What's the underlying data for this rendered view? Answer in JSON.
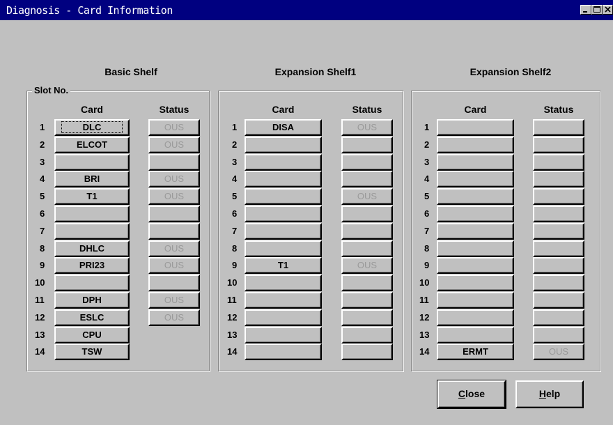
{
  "window": {
    "title": "Diagnosis - Card Information"
  },
  "titlebar_buttons": [
    "minimize-icon",
    "maximize-icon",
    "close-icon"
  ],
  "group_label": "Slot No.",
  "column_headers": {
    "card": "Card",
    "status": "Status"
  },
  "shelves": [
    {
      "title": "Basic Shelf",
      "slots": [
        {
          "num": "1",
          "card": "DLC",
          "status": "OUS",
          "status_visible": true,
          "focused": true
        },
        {
          "num": "2",
          "card": "ELCOT",
          "status": "OUS",
          "status_visible": true
        },
        {
          "num": "3",
          "card": "",
          "status": "",
          "status_visible": true
        },
        {
          "num": "4",
          "card": "BRI",
          "status": "OUS",
          "status_visible": true
        },
        {
          "num": "5",
          "card": "T1",
          "status": "OUS",
          "status_visible": true
        },
        {
          "num": "6",
          "card": "",
          "status": "",
          "status_visible": true
        },
        {
          "num": "7",
          "card": "",
          "status": "",
          "status_visible": true
        },
        {
          "num": "8",
          "card": "DHLC",
          "status": "OUS",
          "status_visible": true
        },
        {
          "num": "9",
          "card": "PRI23",
          "status": "OUS",
          "status_visible": true
        },
        {
          "num": "10",
          "card": "",
          "status": "",
          "status_visible": true
        },
        {
          "num": "11",
          "card": "DPH",
          "status": "OUS",
          "status_visible": true
        },
        {
          "num": "12",
          "card": "ESLC",
          "status": "OUS",
          "status_visible": true
        },
        {
          "num": "13",
          "card": "CPU",
          "status": "",
          "status_visible": false
        },
        {
          "num": "14",
          "card": "TSW",
          "status": "",
          "status_visible": false
        }
      ]
    },
    {
      "title": "Expansion Shelf1",
      "slots": [
        {
          "num": "1",
          "card": "DISA",
          "status": "OUS",
          "status_visible": true
        },
        {
          "num": "2",
          "card": "",
          "status": "",
          "status_visible": true
        },
        {
          "num": "3",
          "card": "",
          "status": "",
          "status_visible": true
        },
        {
          "num": "4",
          "card": "",
          "status": "",
          "status_visible": true
        },
        {
          "num": "5",
          "card": "",
          "status": "OUS",
          "status_visible": true
        },
        {
          "num": "6",
          "card": "",
          "status": "",
          "status_visible": true
        },
        {
          "num": "7",
          "card": "",
          "status": "",
          "status_visible": true
        },
        {
          "num": "8",
          "card": "",
          "status": "",
          "status_visible": true
        },
        {
          "num": "9",
          "card": "T1",
          "status": "OUS",
          "status_visible": true
        },
        {
          "num": "10",
          "card": "",
          "status": "",
          "status_visible": true
        },
        {
          "num": "11",
          "card": "",
          "status": "",
          "status_visible": true
        },
        {
          "num": "12",
          "card": "",
          "status": "",
          "status_visible": true
        },
        {
          "num": "13",
          "card": "",
          "status": "",
          "status_visible": true
        },
        {
          "num": "14",
          "card": "",
          "status": "",
          "status_visible": true
        }
      ]
    },
    {
      "title": "Expansion Shelf2",
      "slots": [
        {
          "num": "1",
          "card": "",
          "status": "",
          "status_visible": true
        },
        {
          "num": "2",
          "card": "",
          "status": "",
          "status_visible": true
        },
        {
          "num": "3",
          "card": "",
          "status": "",
          "status_visible": true
        },
        {
          "num": "4",
          "card": "",
          "status": "",
          "status_visible": true
        },
        {
          "num": "5",
          "card": "",
          "status": "",
          "status_visible": true
        },
        {
          "num": "6",
          "card": "",
          "status": "",
          "status_visible": true
        },
        {
          "num": "7",
          "card": "",
          "status": "",
          "status_visible": true
        },
        {
          "num": "8",
          "card": "",
          "status": "",
          "status_visible": true
        },
        {
          "num": "9",
          "card": "",
          "status": "",
          "status_visible": true
        },
        {
          "num": "10",
          "card": "",
          "status": "",
          "status_visible": true
        },
        {
          "num": "11",
          "card": "",
          "status": "",
          "status_visible": true
        },
        {
          "num": "12",
          "card": "",
          "status": "",
          "status_visible": true
        },
        {
          "num": "13",
          "card": "",
          "status": "",
          "status_visible": true
        },
        {
          "num": "14",
          "card": "ERMT",
          "status": "OUS",
          "status_visible": true
        }
      ]
    }
  ],
  "buttons": {
    "close": "Close",
    "close_mnemonic": "C",
    "help": "Help",
    "help_mnemonic": "H"
  },
  "colors": {
    "titlebar": "#000080",
    "face": "#c0c0c0",
    "disabled_text": "#9a9a9a"
  }
}
